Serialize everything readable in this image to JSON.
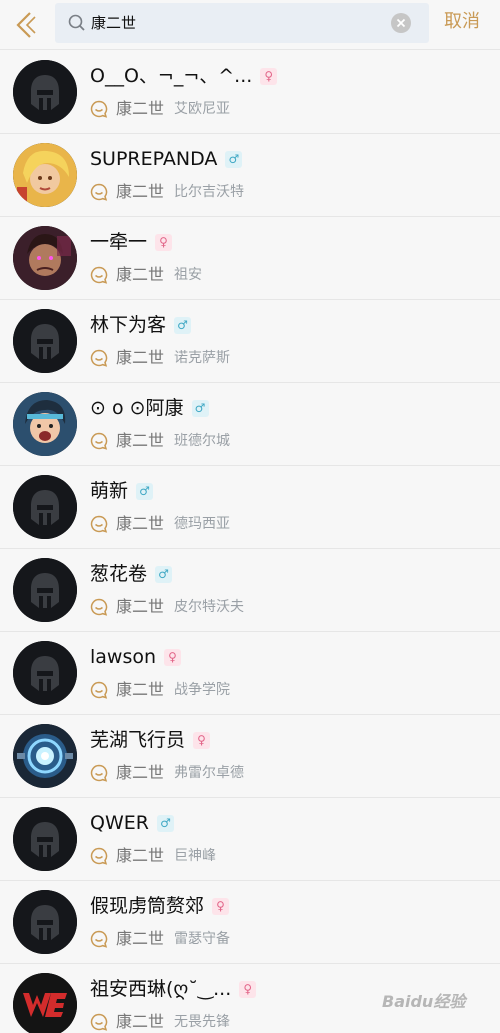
{
  "header": {
    "search_value": "康二世",
    "cancel_label": "取消"
  },
  "results": [
    {
      "name": "O__O、¬_¬、^...",
      "gender": "female",
      "gender_symbol": "♀",
      "game_name": "康二世",
      "server": "艾欧尼亚",
      "avatar": "helmet-icon"
    },
    {
      "name": "SUPREPANDA",
      "gender": "male",
      "gender_symbol": "♂",
      "game_name": "康二世",
      "server": "比尔吉沃特",
      "avatar": "blonde-warrior-portrait"
    },
    {
      "name": "一牵一",
      "gender": "female",
      "gender_symbol": "♀",
      "game_name": "康二世",
      "server": "祖安",
      "avatar": "dark-warrior-portrait"
    },
    {
      "name": "林下为客",
      "gender": "male",
      "gender_symbol": "♂",
      "game_name": "康二世",
      "server": "诺克萨斯",
      "avatar": "helmet-icon"
    },
    {
      "name": "⊙ o ⊙阿康",
      "gender": "male",
      "gender_symbol": "♂",
      "game_name": "康二世",
      "server": "班德尔城",
      "avatar": "shouting-hero-portrait"
    },
    {
      "name": "萌新",
      "gender": "male",
      "gender_symbol": "♂",
      "game_name": "康二世",
      "server": "德玛西亚",
      "avatar": "helmet-icon"
    },
    {
      "name": "葱花卷",
      "gender": "male",
      "gender_symbol": "♂",
      "game_name": "康二世",
      "server": "皮尔特沃夫",
      "avatar": "helmet-icon"
    },
    {
      "name": "lawson",
      "gender": "female",
      "gender_symbol": "♀",
      "game_name": "康二世",
      "server": "战争学院",
      "avatar": "helmet-icon"
    },
    {
      "name": "芜湖飞行员",
      "gender": "female",
      "gender_symbol": "♀",
      "game_name": "康二世",
      "server": "弗雷尔卓德",
      "avatar": "blue-core-emblem"
    },
    {
      "name": "QWER",
      "gender": "male",
      "gender_symbol": "♂",
      "game_name": "康二世",
      "server": "巨神峰",
      "avatar": "helmet-icon"
    },
    {
      "name": "假现虏筒赘郊",
      "gender": "female",
      "gender_symbol": "♀",
      "game_name": "康二世",
      "server": "雷瑟守备",
      "avatar": "helmet-icon"
    },
    {
      "name": "祖安西琳(ღ˘‿...",
      "gender": "female",
      "gender_symbol": "♀",
      "game_name": "康二世",
      "server": "无畏先锋",
      "avatar": "we-team-logo"
    }
  ],
  "watermark": "Baidu经验"
}
